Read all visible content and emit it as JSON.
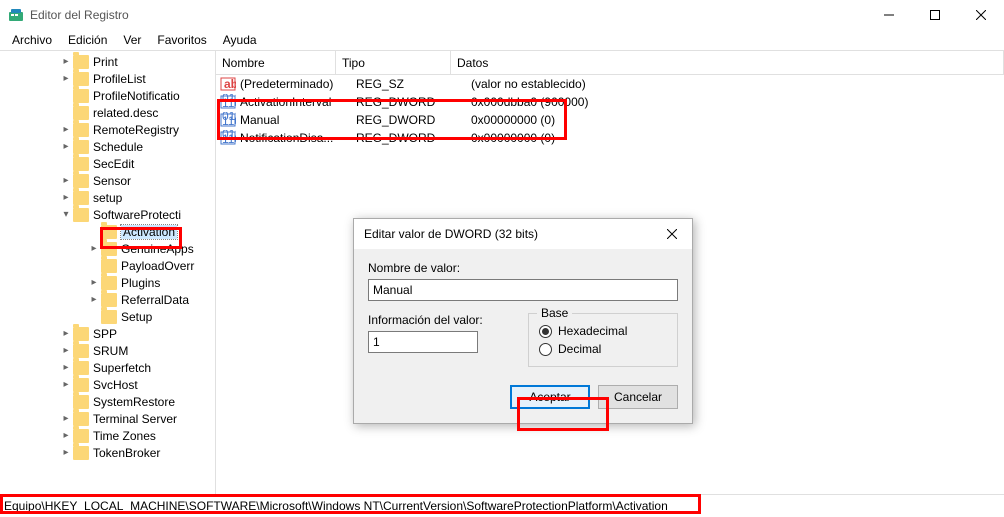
{
  "window": {
    "title": "Editor del Registro",
    "menu": [
      "Archivo",
      "Edición",
      "Ver",
      "Favoritos",
      "Ayuda"
    ]
  },
  "tree": {
    "items": [
      {
        "label": "Print",
        "exp": ">",
        "depth": 0
      },
      {
        "label": "ProfileList",
        "exp": ">",
        "depth": 0
      },
      {
        "label": "ProfileNotificatio",
        "exp": "",
        "depth": 0
      },
      {
        "label": "related.desc",
        "exp": "",
        "depth": 0
      },
      {
        "label": "RemoteRegistry",
        "exp": ">",
        "depth": 0
      },
      {
        "label": "Schedule",
        "exp": ">",
        "depth": 0
      },
      {
        "label": "SecEdit",
        "exp": "",
        "depth": 0
      },
      {
        "label": "Sensor",
        "exp": ">",
        "depth": 0
      },
      {
        "label": "setup",
        "exp": ">",
        "depth": 0
      },
      {
        "label": "SoftwareProtecti",
        "exp": "v",
        "depth": 0
      },
      {
        "label": "Activation",
        "exp": "",
        "depth": 1,
        "selected": true
      },
      {
        "label": "GenuineApps",
        "exp": ">",
        "depth": 1
      },
      {
        "label": "PayloadOverr",
        "exp": "",
        "depth": 1
      },
      {
        "label": "Plugins",
        "exp": ">",
        "depth": 1
      },
      {
        "label": "ReferralData",
        "exp": ">",
        "depth": 1
      },
      {
        "label": "Setup",
        "exp": "",
        "depth": 1
      },
      {
        "label": "SPP",
        "exp": ">",
        "depth": 0
      },
      {
        "label": "SRUM",
        "exp": ">",
        "depth": 0
      },
      {
        "label": "Superfetch",
        "exp": ">",
        "depth": 0
      },
      {
        "label": "SvcHost",
        "exp": ">",
        "depth": 0
      },
      {
        "label": "SystemRestore",
        "exp": "",
        "depth": 0
      },
      {
        "label": "Terminal Server",
        "exp": ">",
        "depth": 0
      },
      {
        "label": "Time Zones",
        "exp": ">",
        "depth": 0
      },
      {
        "label": "TokenBroker",
        "exp": ">",
        "depth": 0
      }
    ]
  },
  "list": {
    "headers": {
      "name": "Nombre",
      "type": "Tipo",
      "data": "Datos"
    },
    "rows": [
      {
        "name": "(Predeterminado)",
        "type": "REG_SZ",
        "data": "(valor no establecido)",
        "ico": "str"
      },
      {
        "name": "ActivationInterval",
        "type": "REG_DWORD",
        "data": "0x000dbba0 (900000)",
        "ico": "bin"
      },
      {
        "name": "Manual",
        "type": "REG_DWORD",
        "data": "0x00000000 (0)",
        "ico": "bin"
      },
      {
        "name": "NotificationDisa...",
        "type": "REG_DWORD",
        "data": "0x00000000 (0)",
        "ico": "bin"
      }
    ]
  },
  "dialog": {
    "title": "Editar valor de DWORD (32 bits)",
    "name_label": "Nombre de valor:",
    "name_value": "Manual",
    "value_label": "Información del valor:",
    "value_value": "1",
    "base_label": "Base",
    "radio_hex": "Hexadecimal",
    "radio_dec": "Decimal",
    "ok": "Aceptar",
    "cancel": "Cancelar"
  },
  "status": {
    "path": "Equipo\\HKEY_LOCAL_MACHINE\\SOFTWARE\\Microsoft\\Windows NT\\CurrentVersion\\SoftwareProtectionPlatform\\Activation"
  }
}
